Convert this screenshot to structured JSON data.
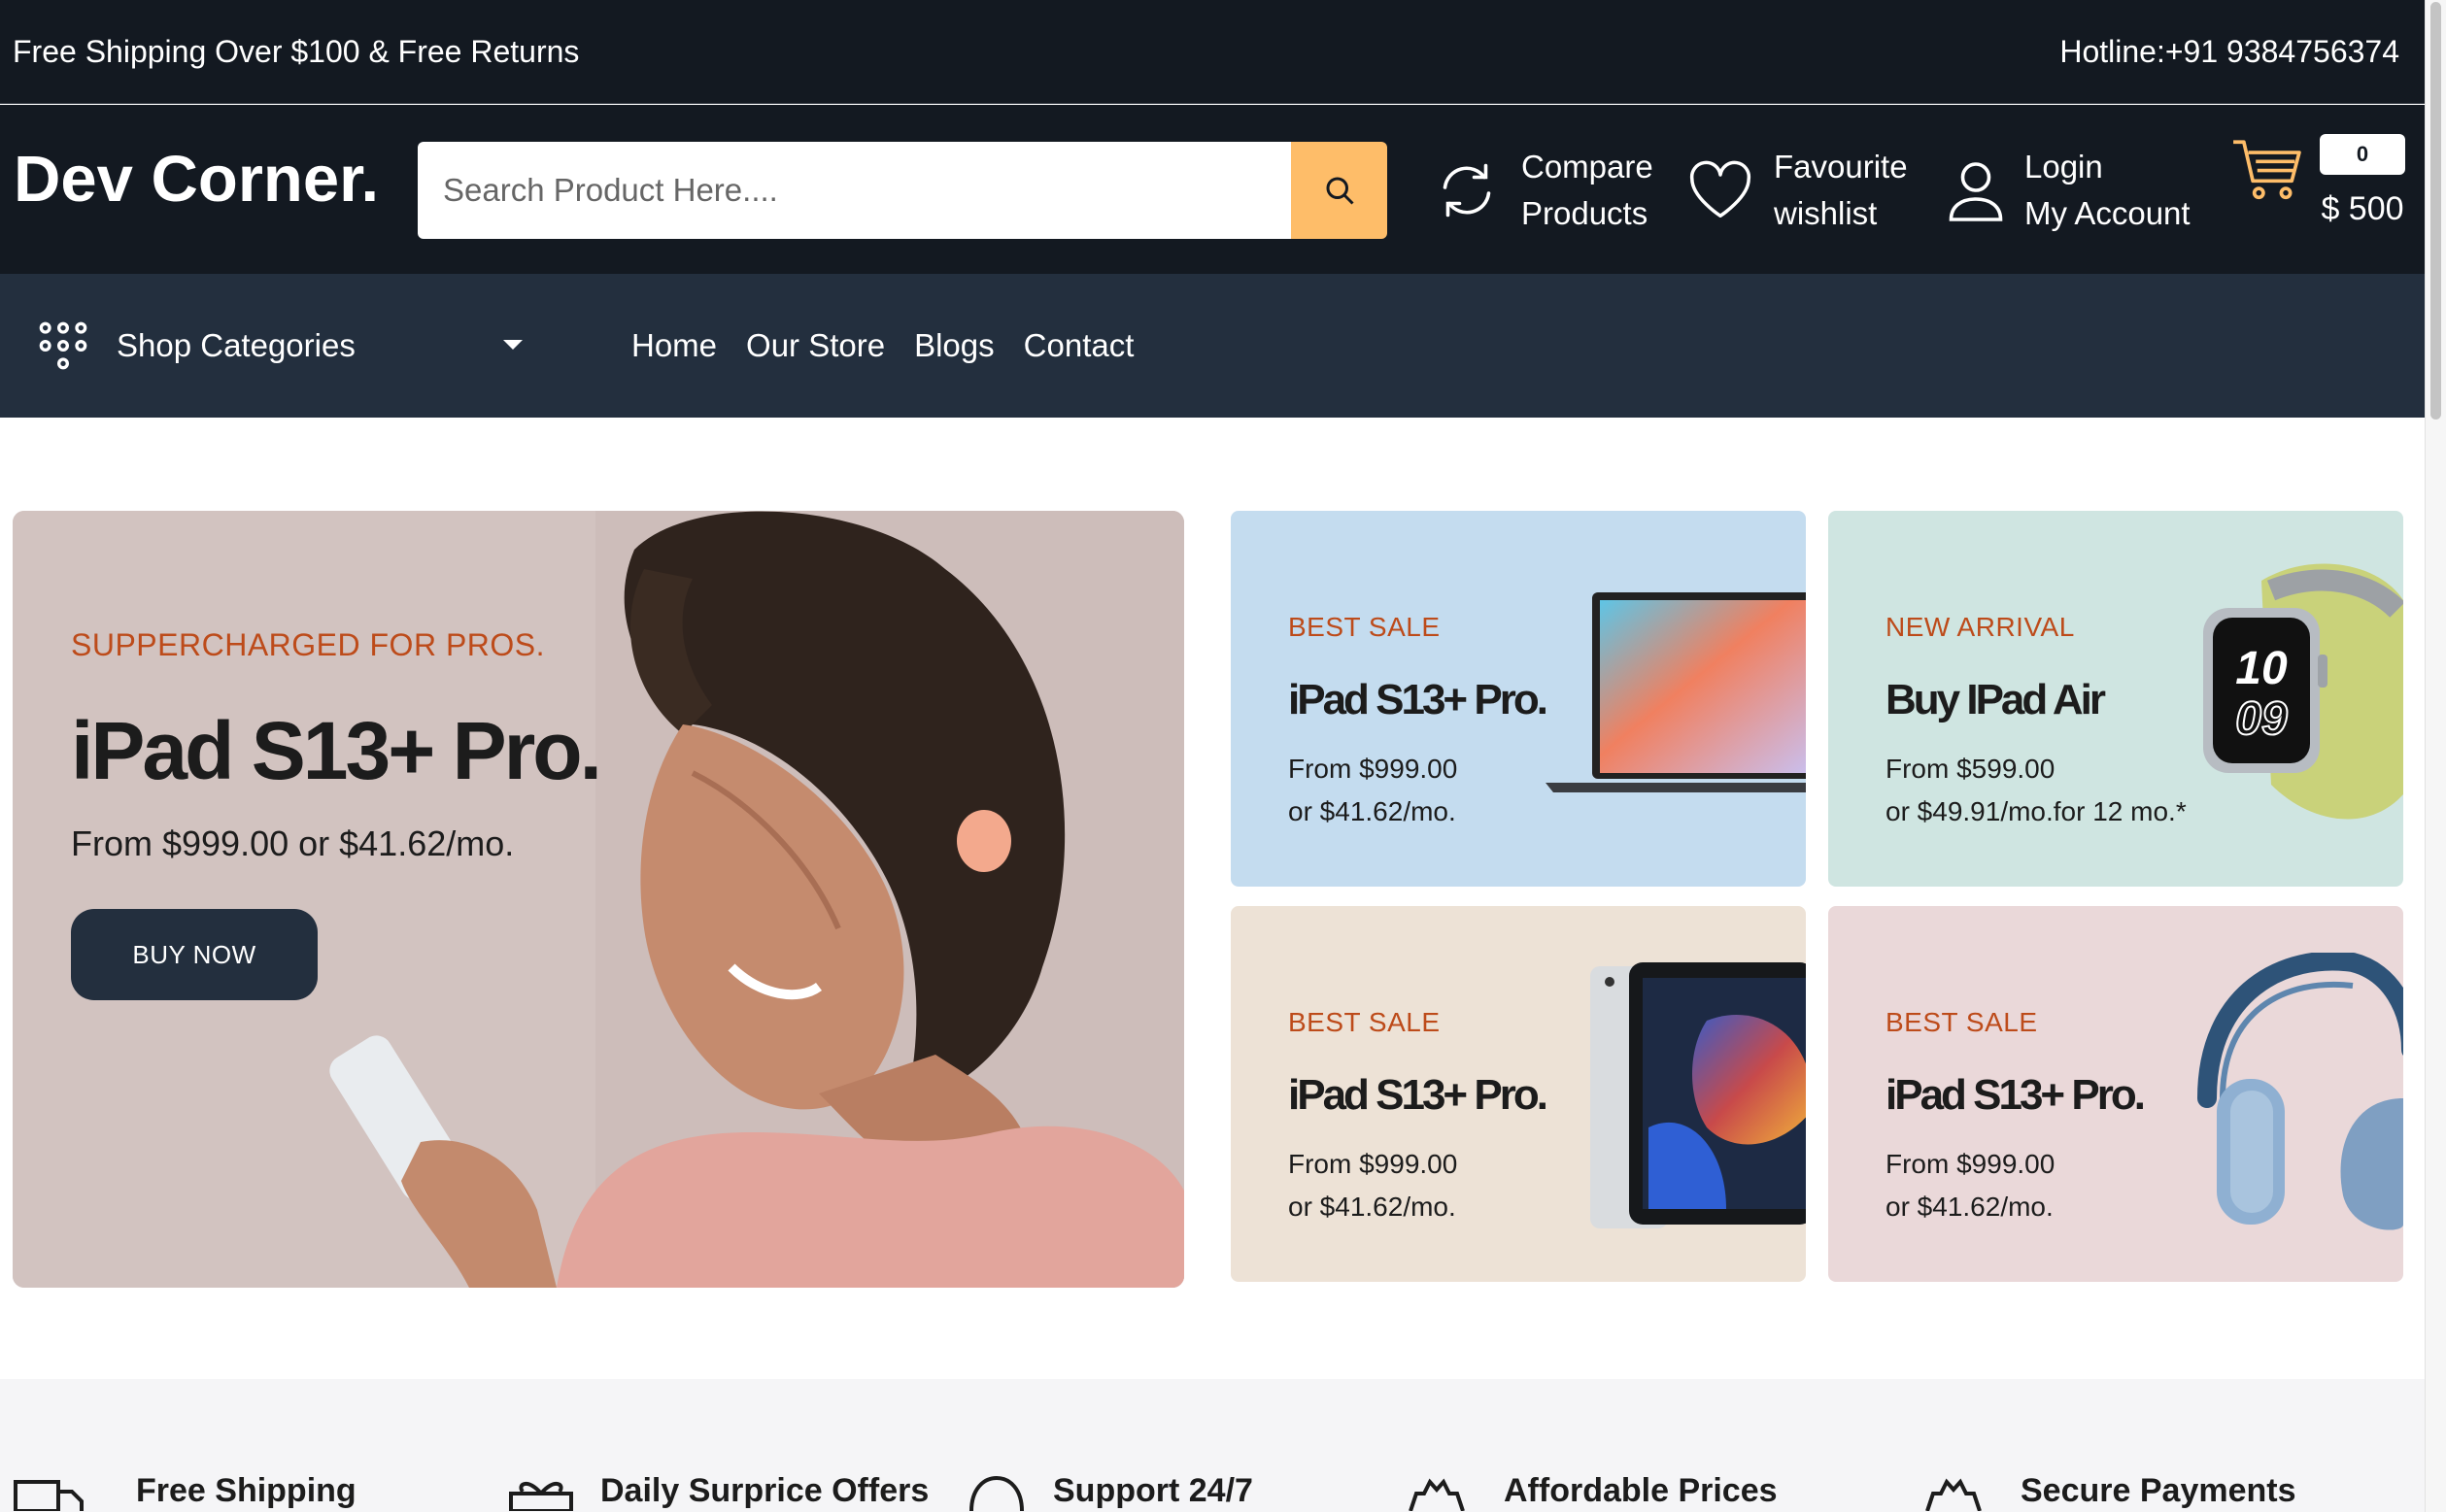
{
  "topbar": {
    "left_text": "Free Shipping Over $100 & Free Returns",
    "hotline": "Hotline:+91 9384756374"
  },
  "header": {
    "logo": "Dev Corner.",
    "search_placeholder": "Search Product Here....",
    "compare": {
      "line1": "Compare",
      "line2": "Products",
      "icon": "compare-icon"
    },
    "wishlist": {
      "line1": "Favourite",
      "line2": "wishlist",
      "icon": "heart-icon"
    },
    "account": {
      "line1": "Login",
      "line2": "My Account",
      "icon": "user-icon"
    },
    "cart": {
      "count": "0",
      "total": "$ 500",
      "icon": "cart-icon"
    }
  },
  "nav": {
    "categories_label": "Shop Categories",
    "links": [
      "Home",
      "Our Store",
      "Blogs",
      "Contact"
    ]
  },
  "hero": {
    "kicker": "SUPPERCHARGED FOR PROS.",
    "title": "iPad S13+ Pro.",
    "price": "From $999.00 or $41.62/mo.",
    "button": "BUY NOW"
  },
  "banners": [
    {
      "kicker": "BEST SALE",
      "title": "iPad S13+ Pro.",
      "line1": "From $999.00",
      "line2": "or $41.62/mo.",
      "bg": "#c4dcef",
      "product": "laptop"
    },
    {
      "kicker": "NEW ARRIVAL",
      "title": "Buy IPad Air",
      "line1": "From $599.00",
      "line2": "or $49.91/mo.for 12 mo.*",
      "bg": "#cfe5e1",
      "product": "watch"
    },
    {
      "kicker": "BEST SALE",
      "title": "iPad S13+ Pro.",
      "line1": "From $999.00",
      "line2": "or $41.62/mo.",
      "bg": "#ede2d6",
      "product": "tablet"
    },
    {
      "kicker": "BEST SALE",
      "title": "iPad S13+ Pro.",
      "line1": "From $999.00",
      "line2": "or $41.62/mo.",
      "bg": "#ead8d9",
      "product": "headphones"
    }
  ],
  "services": [
    {
      "title": "Free Shipping",
      "icon": "truck-icon"
    },
    {
      "title": "Daily Surprice Offers",
      "icon": "gift-icon"
    },
    {
      "title": "Support 24/7",
      "icon": "headset-icon"
    },
    {
      "title": "Affordable Prices",
      "icon": "price-badge-icon"
    },
    {
      "title": "Secure Payments",
      "icon": "secure-badge-icon"
    }
  ]
}
